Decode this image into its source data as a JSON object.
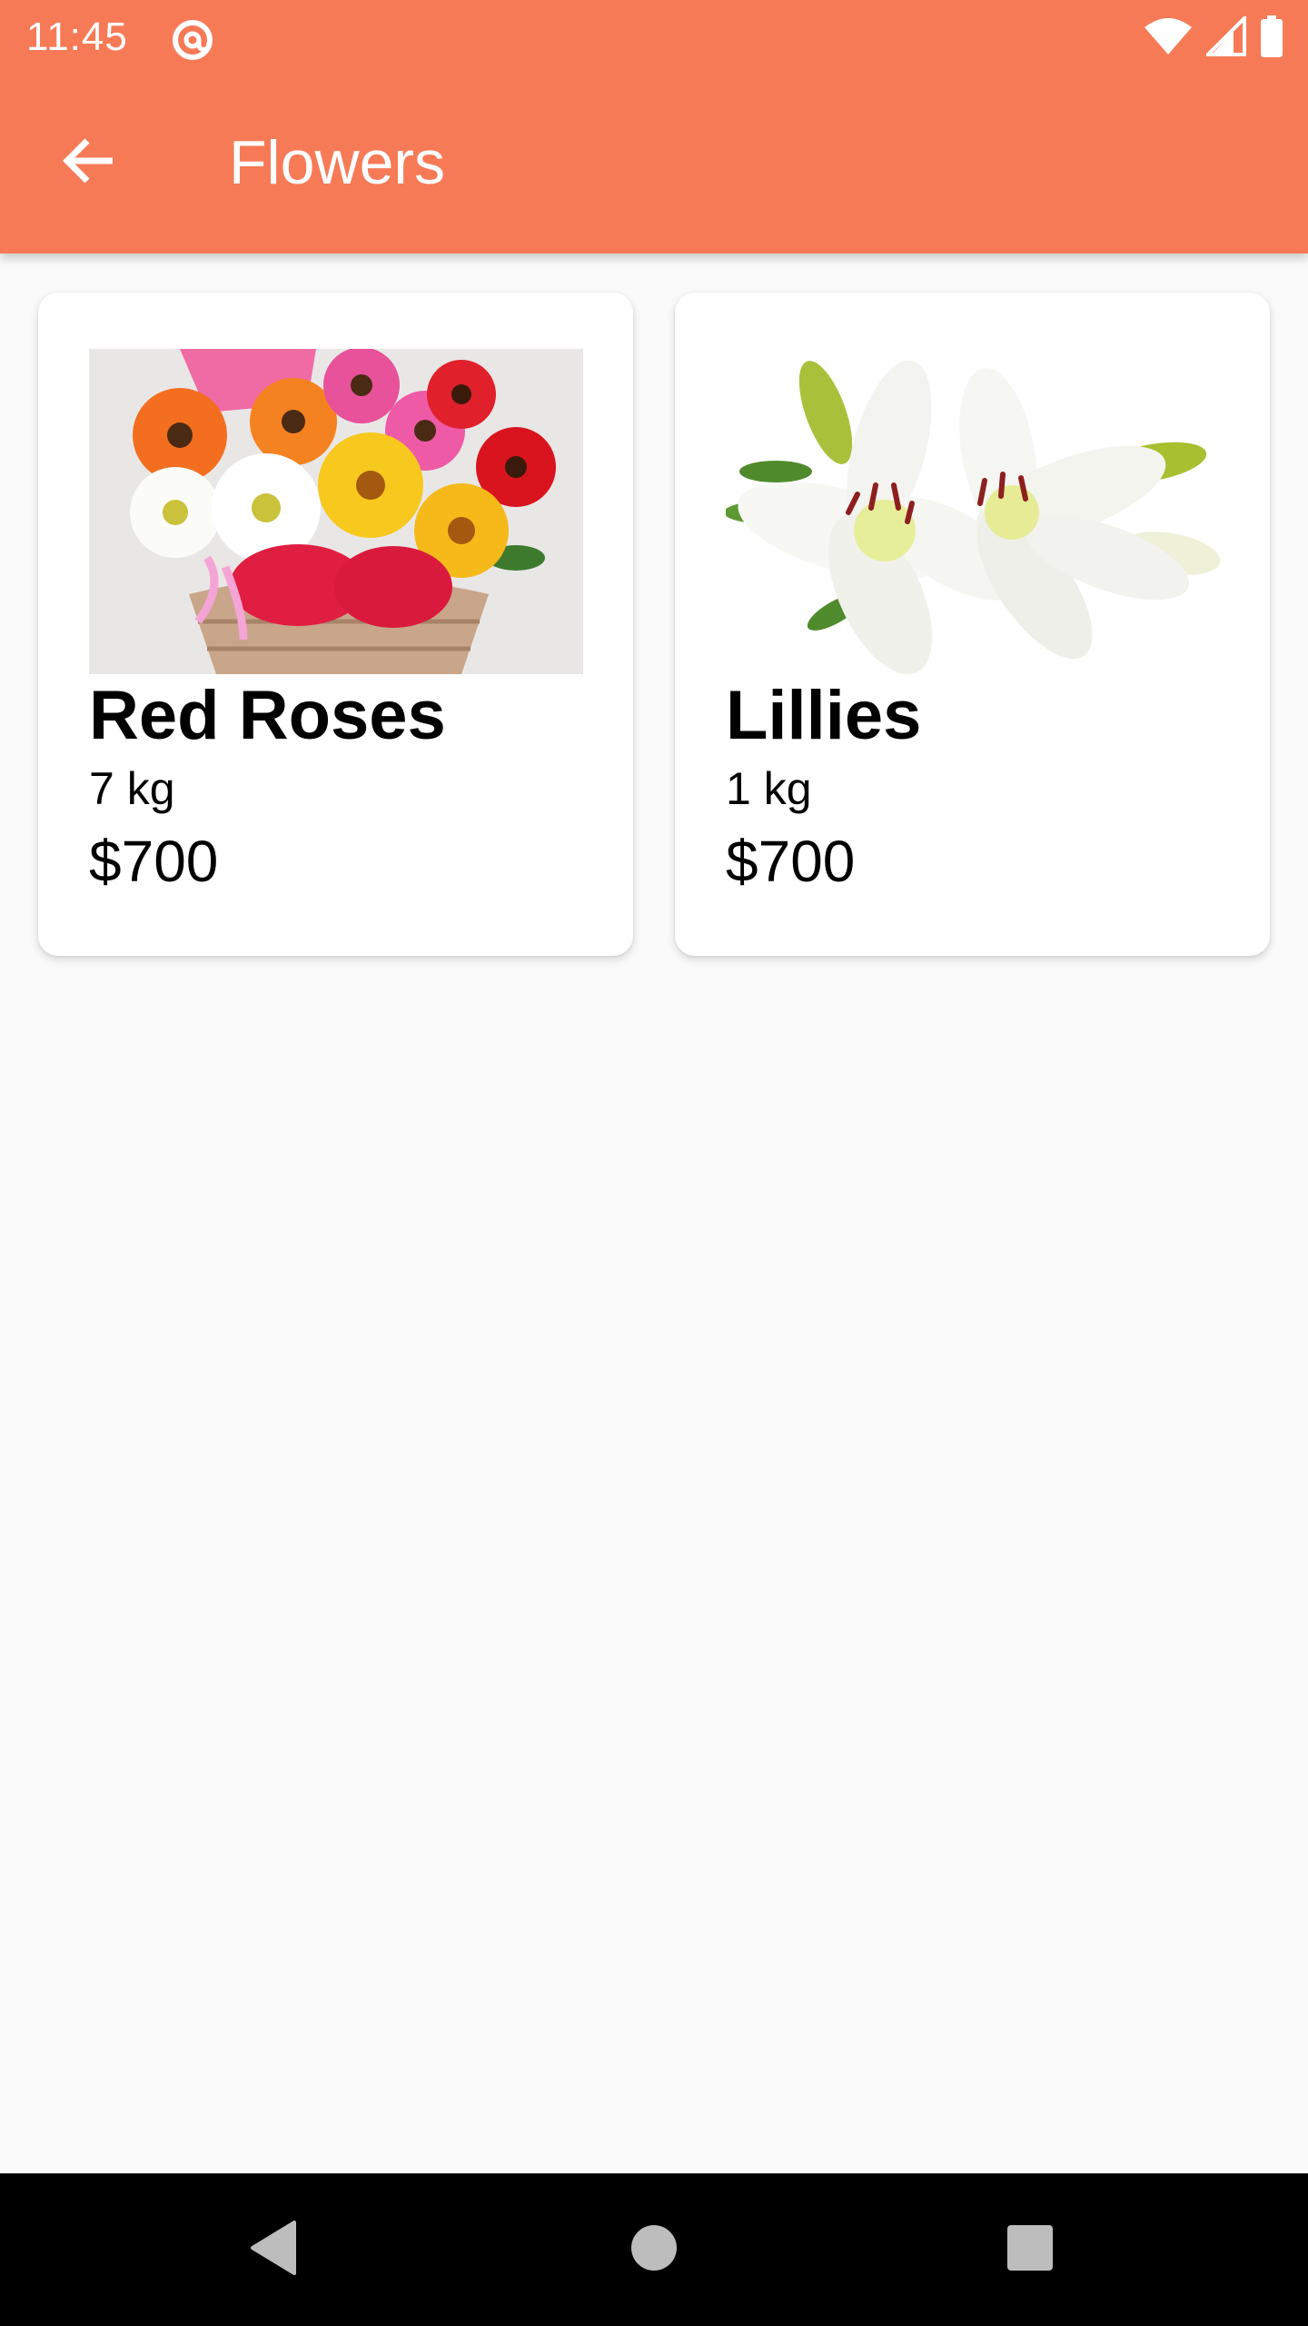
{
  "status_bar": {
    "time": "11:45",
    "icons": [
      "at-sign-icon",
      "wifi-icon",
      "signal-icon",
      "battery-icon"
    ]
  },
  "app_bar": {
    "title": "Flowers",
    "back_icon": "arrow-back-icon",
    "color": "#f77a57"
  },
  "products": [
    {
      "name": "Red Roses",
      "weight": "7 kg",
      "price": "$700",
      "image": "flower-basket-image"
    },
    {
      "name": "Lillies",
      "weight": "1 kg",
      "price": "$700",
      "image": "white-lilies-image"
    }
  ],
  "nav_bar": {
    "buttons": [
      "back-triangle-icon",
      "home-circle-icon",
      "recents-square-icon"
    ]
  }
}
